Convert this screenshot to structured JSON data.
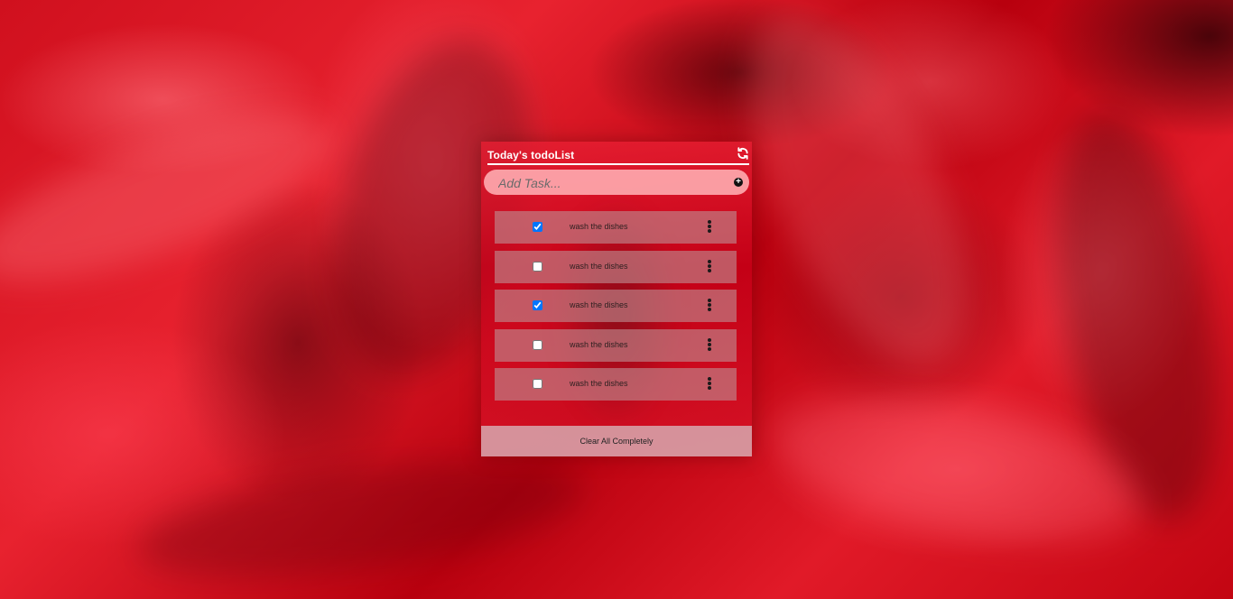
{
  "app": {
    "title": "Today's todoList"
  },
  "add_task": {
    "placeholder": "Add Task...",
    "value": ""
  },
  "icons": {
    "refresh": "refresh-icon",
    "add": "plus-circle-icon",
    "menu": "kebab-menu-icon"
  },
  "tasks": [
    {
      "text": "wash the dishes",
      "checked": true
    },
    {
      "text": "wash the dishes",
      "checked": false
    },
    {
      "text": "wash the dishes",
      "checked": true
    },
    {
      "text": "wash the dishes",
      "checked": false
    },
    {
      "text": "wash the dishes",
      "checked": false
    }
  ],
  "footer": {
    "clear_label": "Clear All Completely"
  },
  "colors": {
    "accent": "#d0101e",
    "checkbox_checked": "#0075ff"
  }
}
